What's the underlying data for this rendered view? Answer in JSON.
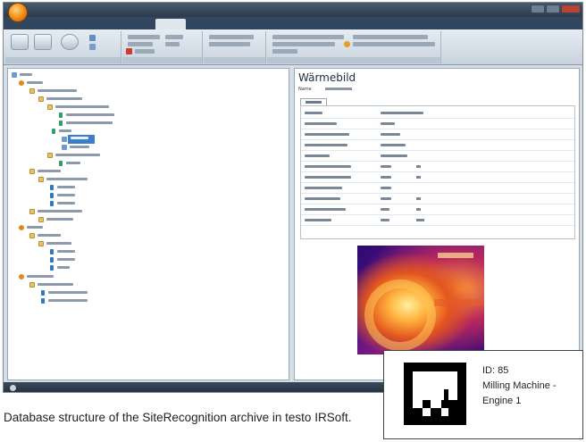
{
  "detail": {
    "title": "Wärmebild",
    "name_label": "Name"
  },
  "caption": "Database structure of the SiteRecognition archive in testo IRSoft.",
  "tag": {
    "id": "ID: 85",
    "name_line1": "Milling Machine -",
    "name_line2": "Engine 1"
  },
  "colors": {
    "accent_orb": "#f08a12",
    "selection": "#3d7ecb",
    "titlebar": "#2c3a4b"
  }
}
